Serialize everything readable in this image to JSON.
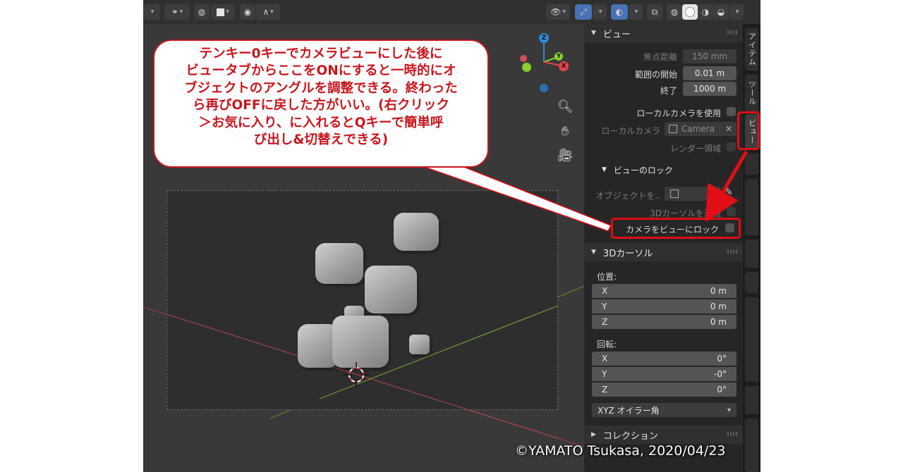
{
  "viewport": {
    "axis_labels": {
      "z": "Z",
      "y": "Y",
      "x": "X"
    }
  },
  "panel": {
    "view_section": {
      "header": "ビュー",
      "focal_length": {
        "label": "焦点距離",
        "value": "150 mm"
      },
      "clip_start": {
        "label": "範囲の開始",
        "value": "0.01 m"
      },
      "clip_end": {
        "label": "終了",
        "value": "1000 m"
      },
      "use_local_camera": {
        "label": "ローカルカメラを使用"
      },
      "local_camera": {
        "label": "ローカルカメラ",
        "value": "Camera"
      },
      "render_region": {
        "label": "レンダー領域"
      }
    },
    "view_lock": {
      "header": "ビューのロック",
      "lock_object": {
        "label": "オブジェクトを.."
      },
      "lock_cursor": {
        "label": "3Dカーソルを注視"
      },
      "lock_camera": {
        "label": "カメラをビューにロック"
      }
    },
    "cursor_section": {
      "header": "3Dカーソル",
      "location_label": "位置:",
      "location": [
        {
          "axis": "X",
          "value": "0 m"
        },
        {
          "axis": "Y",
          "value": "0 m"
        },
        {
          "axis": "Z",
          "value": "0 m"
        }
      ],
      "rotation_label": "回転:",
      "rotation": [
        {
          "axis": "X",
          "value": "0°"
        },
        {
          "axis": "Y",
          "value": "-0°"
        },
        {
          "axis": "Z",
          "value": "0°"
        }
      ],
      "rotation_mode": "XYZ オイラー角"
    },
    "collection_section": {
      "header": "コレクション"
    }
  },
  "tabs": [
    "アイテム",
    "ツール",
    "ビュー"
  ],
  "annotation": {
    "lines": [
      "テンキー0キーでカメラビューにした後に",
      "ビュータブからここをONにすると一時的にオ",
      "ブジェクトのアングルを調整できる。終わった",
      "ら再びOFFに戻した方がいい。(右クリック",
      "＞お気に入り、に入れるとQキーで簡単呼",
      "び出し&切替えできる)"
    ]
  },
  "credit": "©YAMATO Tsukasa, 2020/04/23",
  "colors": {
    "annotation_red": "#e10d17",
    "accent_blue": "#4772b3",
    "axis_x": "#e0454f",
    "axis_y": "#8bcf2c",
    "axis_z": "#2e8bd8"
  }
}
